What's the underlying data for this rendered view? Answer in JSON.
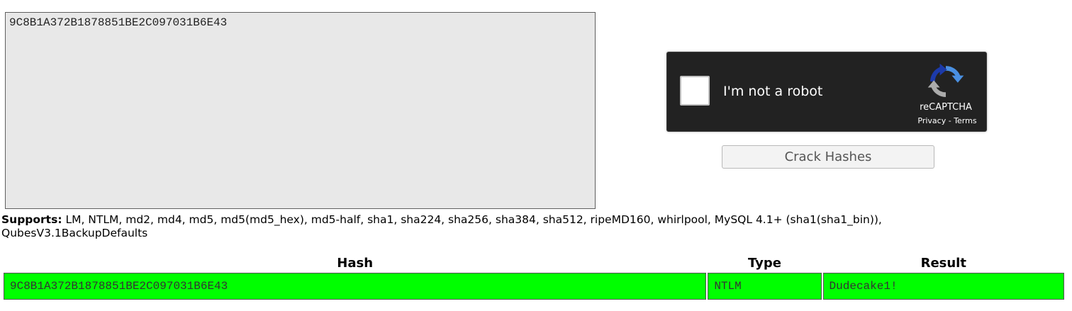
{
  "hash_input": {
    "value": "9C8B1A372B1878851BE2C097031B6E43"
  },
  "captcha": {
    "label": "I'm not a robot",
    "brand": "reCAPTCHA",
    "privacy_link": "Privacy",
    "separator": " - ",
    "terms_link": "Terms",
    "logo_icon": "recaptcha-logo-icon"
  },
  "crack_button": {
    "label": "Crack Hashes"
  },
  "supports": {
    "label": "Supports:",
    "text": " LM, NTLM, md2, md4, md5, md5(md5_hex), md5-half, sha1, sha224, sha256, sha384, sha512, ripeMD160, whirlpool, MySQL 4.1+ (sha1(sha1_bin)), QubesV3.1BackupDefaults"
  },
  "results": {
    "headers": {
      "hash": "Hash",
      "type": "Type",
      "result": "Result"
    },
    "rows": [
      {
        "hash": "9C8B1A372B1878851BE2C097031B6E43",
        "type": "NTLM",
        "result": "Dudecake1!"
      }
    ],
    "success_color": "#00ff00"
  }
}
